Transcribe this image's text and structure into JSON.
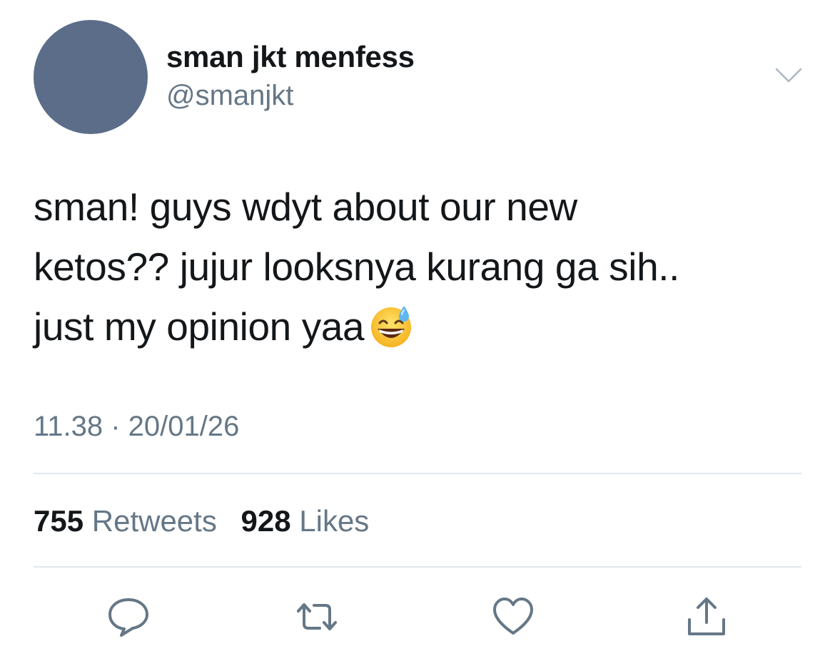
{
  "account": {
    "display_name": "sman jkt menfess",
    "handle": "@smanjkt",
    "avatar_color": "#5b6d89",
    "menu_icon": "chevron-down-icon"
  },
  "tweet": {
    "lines": [
      "sman! guys wdyt about our new",
      "ketos?? jujur looksnya kurang ga sih..",
      "just my opinion yaa"
    ],
    "emoji": "grinning-face-with-sweat-icon"
  },
  "meta": {
    "timestamp": "11.38 · 20/01/26"
  },
  "stats": {
    "retweets_count": "755",
    "retweets_label": "Retweets",
    "likes_count": "928",
    "likes_label": "Likes"
  },
  "actions": [
    {
      "name": "reply",
      "icon": "reply-icon"
    },
    {
      "name": "retweet",
      "icon": "retweet-icon"
    },
    {
      "name": "like",
      "icon": "heart-icon"
    },
    {
      "name": "share",
      "icon": "share-icon"
    }
  ],
  "colors": {
    "text_primary": "#14171a",
    "text_secondary": "#657786",
    "divider": "#e1e8ed",
    "icon": "#657786"
  }
}
